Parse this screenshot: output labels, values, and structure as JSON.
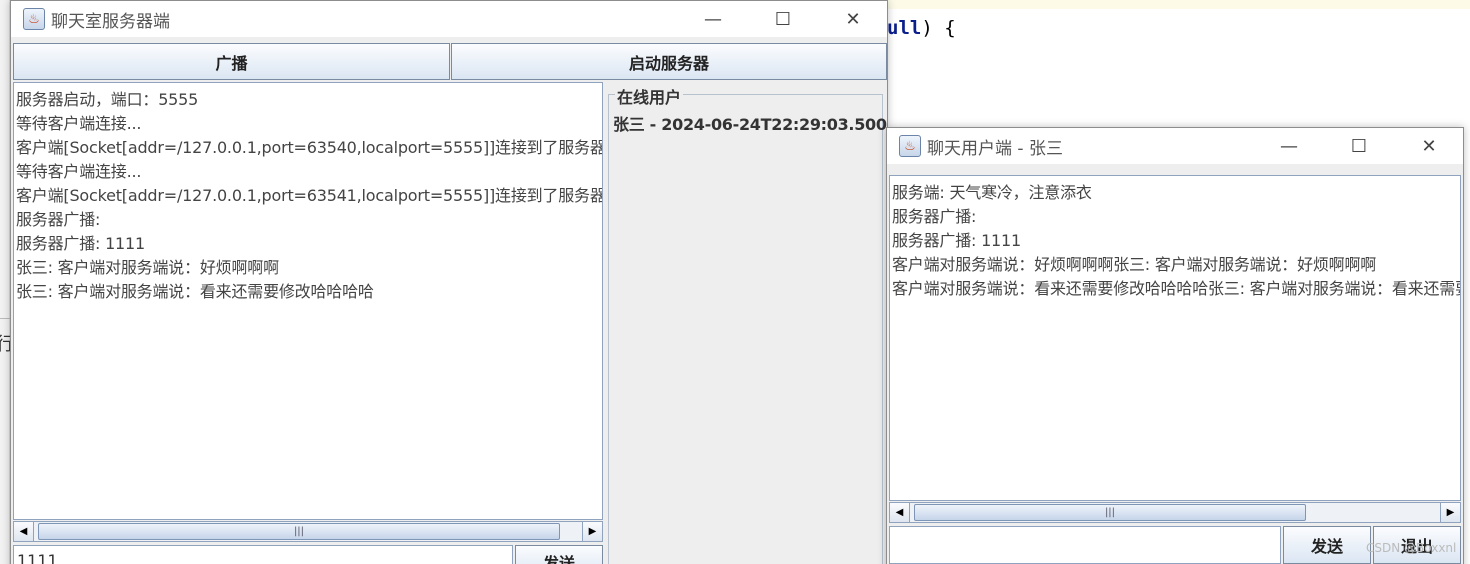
{
  "ide": {
    "code_fragment": "ull",
    "code_rest": ") {",
    "left_glyph": "行"
  },
  "server": {
    "title": "聊天室服务器端",
    "broadcast_label": "广播",
    "start_label": "启动服务器",
    "log_lines": [
      "服务器启动，端口：5555",
      "等待客户端连接...",
      "客户端[Socket[addr=/127.0.0.1,port=63540,localport=5555]]连接到了服务器",
      "等待客户端连接...",
      "客户端[Socket[addr=/127.0.0.1,port=63541,localport=5555]]连接到了服务器",
      "服务器广播:",
      "服务器广播: 1111",
      "张三: 客户端对服务端说：好烦啊啊啊",
      "张三: 客户端对服务端说：看来还需要修改哈哈哈哈"
    ],
    "online_title": "在线用户",
    "online_users": [
      "张三 - 2024-06-24T22:29:03.500"
    ],
    "input_value": "1111",
    "send_label": "发送"
  },
  "client": {
    "title": "聊天用户端 - 张三",
    "messages": [
      "服务端: 天气寒冷，注意添衣",
      "服务器广播:",
      "服务器广播: 1111",
      "客户端对服务端说：好烦啊啊啊张三: 客户端对服务端说：好烦啊啊啊",
      "客户端对服务端说：看来还需要修改哈哈哈哈张三: 客户端对服务端说：看来还需要修改哈哈哈哈"
    ],
    "input_value": "",
    "send_label": "发送",
    "exit_label": "退出"
  },
  "window_controls": {
    "minimize": "—",
    "maximize": "☐",
    "close": "✕"
  },
  "watermark": "CSDN @Boxxnl"
}
